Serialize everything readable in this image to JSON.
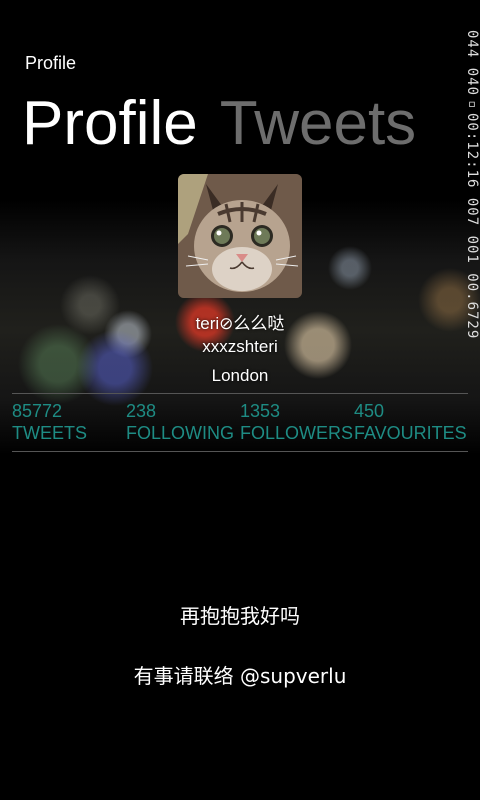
{
  "status": {
    "text": "044 040▫00:12:16 007 001 00.6729"
  },
  "app": {
    "label": "Profile"
  },
  "pivot": {
    "tabs": [
      "Profile",
      "Tweets"
    ],
    "active": "Profile"
  },
  "profile": {
    "display_name": "teri⊘么么哒",
    "username": "xxxzshteri",
    "location": "London"
  },
  "stats": [
    {
      "value": "85772",
      "label": "TWEETS"
    },
    {
      "value": "238",
      "label": "FOLLOWING"
    },
    {
      "value": "1353",
      "label": "FOLLOWERS"
    },
    {
      "value": "450",
      "label": "FAVOURITES"
    }
  ],
  "bio": {
    "line1": "再抱抱我好吗",
    "line2": "有事请联络 @supverlu"
  },
  "colors": {
    "accent": "#1e8c84",
    "inactive_pivot": "#6d6d6d",
    "background": "#000000"
  },
  "icons": {
    "avatar": "cat-photo"
  }
}
